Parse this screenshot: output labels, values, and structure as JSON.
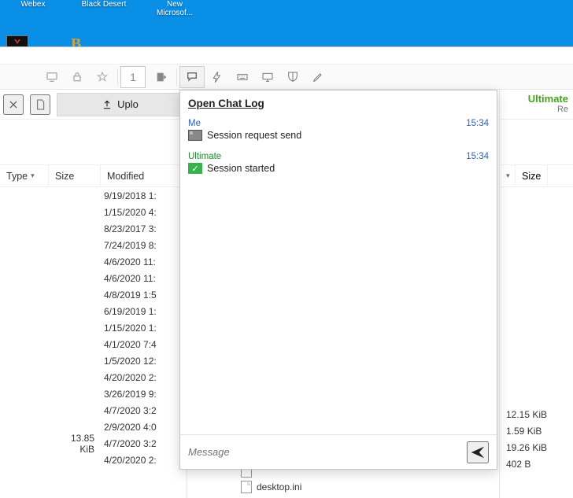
{
  "desktop": {
    "icons": [
      {
        "label": "Webex"
      },
      {
        "label": "Black Desert"
      },
      {
        "label": "New\nMicrosof..."
      }
    ]
  },
  "toolbar": {
    "badge": "1"
  },
  "left": {
    "upload_label": "Uplo",
    "cols": {
      "type": "Type",
      "size": "Size",
      "modified": "Modified"
    },
    "rows": [
      {
        "size": "",
        "modified": "9/19/2018 1:"
      },
      {
        "size": "",
        "modified": "1/15/2020 4:"
      },
      {
        "size": "",
        "modified": "8/23/2017 3:"
      },
      {
        "size": "",
        "modified": "7/24/2019 8:"
      },
      {
        "size": "",
        "modified": "4/6/2020 11:"
      },
      {
        "size": "",
        "modified": "4/6/2020 11:"
      },
      {
        "size": "",
        "modified": "4/8/2019 1:5"
      },
      {
        "size": "",
        "modified": "6/19/2019 1:"
      },
      {
        "size": "",
        "modified": "1/15/2020 1:"
      },
      {
        "size": "",
        "modified": "4/1/2020 7:4"
      },
      {
        "size": "",
        "modified": "1/5/2020 12:"
      },
      {
        "size": "",
        "modified": "4/20/2020 2:"
      },
      {
        "size": "",
        "modified": "3/26/2019 9:"
      },
      {
        "size": "",
        "modified": "4/7/2020 3:2"
      },
      {
        "size": "",
        "modified": "2/9/2020 4:0"
      },
      {
        "size": "13.85 KiB",
        "modified": "4/7/2020 3:2"
      },
      {
        "size": "",
        "modified": "4/20/2020 2:"
      }
    ]
  },
  "chat": {
    "open_log": "Open Chat Log",
    "msgs": [
      {
        "from": "Me",
        "time": "15:34",
        "icon": "screen",
        "text": "Session request send"
      },
      {
        "from": "Ultimate",
        "time": "15:34",
        "icon": "check",
        "text": "Session started"
      }
    ],
    "placeholder": "Message"
  },
  "right": {
    "user": "Ultimate",
    "sub": "Re",
    "col": "Size",
    "rows": [
      {
        "label": "12.15 KiB"
      },
      {
        "label": "1.59 KiB"
      },
      {
        "label": "19.26 KiB"
      },
      {
        "label": "402 B"
      }
    ]
  },
  "bottom_files": [
    {
      "name": ""
    },
    {
      "name": "desktop.ini"
    }
  ]
}
